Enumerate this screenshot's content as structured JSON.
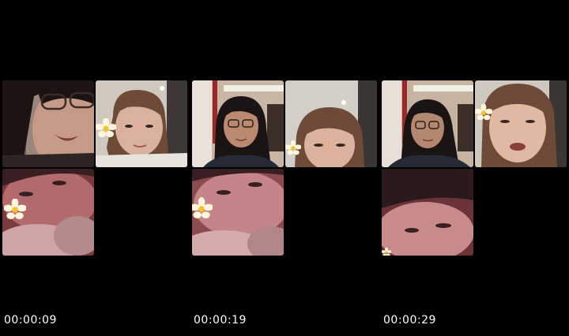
{
  "panels": [
    {
      "timestamp": "00:00:09"
    },
    {
      "timestamp": "00:00:19"
    },
    {
      "timestamp": "00:00:29"
    }
  ],
  "tiles": {
    "top_left": "participant-video",
    "top_right": "participant-video",
    "bottom_left": "participant-video"
  },
  "colors": {
    "background": "#000000",
    "timestamp_text": "#ffffff",
    "flower_petal": "#fff6dc",
    "flower_center": "#f2c230"
  }
}
